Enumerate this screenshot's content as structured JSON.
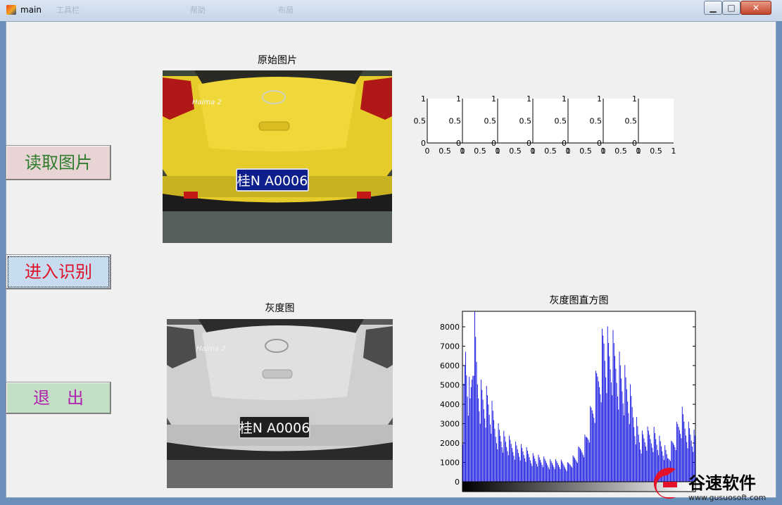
{
  "window": {
    "title": "main",
    "minimize": "▁",
    "maximize": "□",
    "close": "✕"
  },
  "toolbar_ghost": [
    "工具栏",
    "帮助",
    "布局"
  ],
  "titles": {
    "original": "原始图片",
    "gray": "灰度图",
    "histogram": "灰度图直方图"
  },
  "buttons": {
    "read": "读取图片",
    "recognize": "进入识别",
    "exit": "退　出"
  },
  "colors": {
    "read_bg": "#e8d4d4",
    "read_fg": "#2e7d2e",
    "recognize_bg": "#c8dcf0",
    "recognize_fg": "#e0102a",
    "exit_bg": "#c4e0c4",
    "exit_fg": "#b020b0",
    "hist": "#1010e0"
  },
  "plate": {
    "text": "桂N A0006"
  },
  "car": {
    "badge": "Haima 2"
  },
  "small_axes": {
    "count": 7,
    "yticks": [
      "0",
      "0.5",
      "1"
    ],
    "xticks": [
      "0",
      "0.5",
      "1"
    ]
  },
  "watermark": {
    "brand": "谷速软件",
    "url": "www.gusuosoft.com"
  },
  "chart_data": {
    "type": "bar",
    "title": "灰度图直方图",
    "xlim": [
      0,
      255
    ],
    "ylim": [
      0,
      8800
    ],
    "yticks": [
      0,
      1000,
      2000,
      3000,
      4000,
      5000,
      6000,
      7000,
      8000
    ],
    "bins": 256,
    "values_sampled": [
      {
        "x": 0,
        "y": 3500
      },
      {
        "x": 3,
        "y": 8000
      },
      {
        "x": 8,
        "y": 4500
      },
      {
        "x": 12,
        "y": 9000
      },
      {
        "x": 16,
        "y": 6200
      },
      {
        "x": 20,
        "y": 5200
      },
      {
        "x": 28,
        "y": 4600
      },
      {
        "x": 36,
        "y": 3200
      },
      {
        "x": 48,
        "y": 2300
      },
      {
        "x": 60,
        "y": 2000
      },
      {
        "x": 75,
        "y": 1500
      },
      {
        "x": 90,
        "y": 1200
      },
      {
        "x": 105,
        "y": 1100
      },
      {
        "x": 115,
        "y": 1000
      },
      {
        "x": 125,
        "y": 1500
      },
      {
        "x": 135,
        "y": 2500
      },
      {
        "x": 145,
        "y": 5000
      },
      {
        "x": 155,
        "y": 8500
      },
      {
        "x": 160,
        "y": 7500
      },
      {
        "x": 168,
        "y": 7200
      },
      {
        "x": 180,
        "y": 5500
      },
      {
        "x": 195,
        "y": 2500
      },
      {
        "x": 210,
        "y": 2800
      },
      {
        "x": 225,
        "y": 1500
      },
      {
        "x": 240,
        "y": 3700
      },
      {
        "x": 255,
        "y": 2500
      }
    ]
  }
}
